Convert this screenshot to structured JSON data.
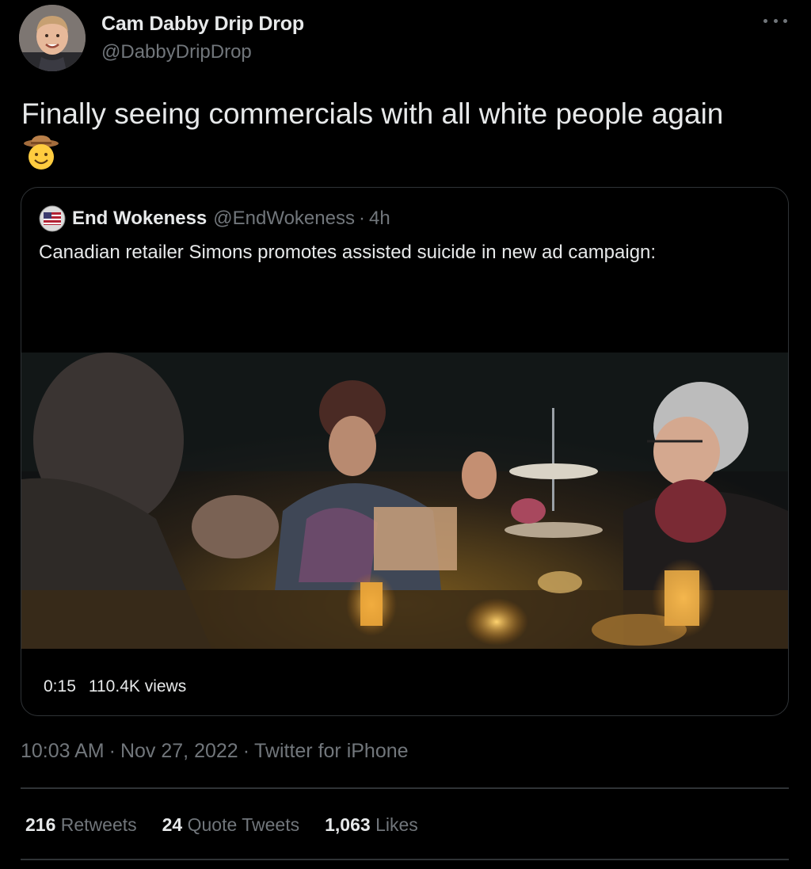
{
  "tweet": {
    "author": {
      "name": "Cam Dabby Drip Drop",
      "handle": "@DabbyDripDrop",
      "avatar_icon": "profile-photo"
    },
    "text": "Finally seeing commercials with all white people again",
    "emoji_icon": "cowboy-face-emoji",
    "more_icon": "more-options-icon",
    "timestamp": "10:03 AM",
    "date": "Nov 27, 2022",
    "source": "Twitter for iPhone",
    "separator": "·",
    "stats": {
      "retweets_count": "216",
      "retweets_label": "Retweets",
      "quotes_count": "24",
      "quotes_label": "Quote Tweets",
      "likes_count": "1,063",
      "likes_label": "Likes"
    }
  },
  "quoted_tweet": {
    "author": {
      "name": "End Wokeness",
      "handle": "@EndWokeness",
      "avatar_icon": "flag-emblem"
    },
    "time_ago": "4h",
    "text": "Canadian retailer Simons promotes assisted suicide in new ad campaign:",
    "video": {
      "duration": "0:15",
      "views": "110.4K views"
    }
  },
  "colors": {
    "background": "#000000",
    "primary_text": "#e7e9ea",
    "secondary_text": "#71767b",
    "border": "#2f3336"
  }
}
